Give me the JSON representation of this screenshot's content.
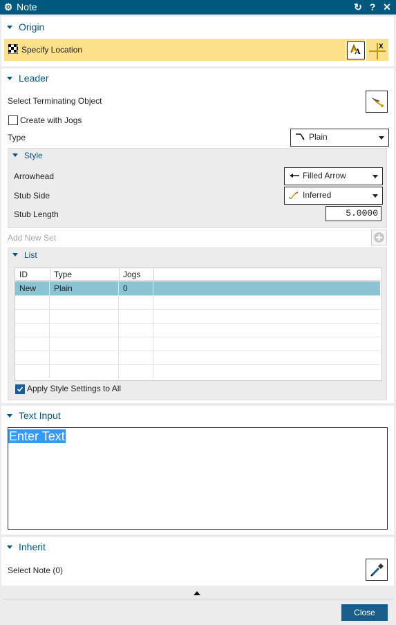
{
  "window": {
    "title": "Note"
  },
  "origin": {
    "header": "Origin",
    "specify_location": "Specify Location"
  },
  "leader": {
    "header": "Leader",
    "select_terminating": "Select Terminating Object",
    "create_with_jogs": "Create with Jogs",
    "create_with_jogs_checked": false,
    "type_label": "Type",
    "type_value": "Plain",
    "style": {
      "header": "Style",
      "arrowhead_label": "Arrowhead",
      "arrowhead_value": "Filled Arrow",
      "stub_side_label": "Stub Side",
      "stub_side_value": "Inferred",
      "stub_length_label": "Stub Length",
      "stub_length_value": "5.0000"
    },
    "add_new_set": "Add New Set",
    "list": {
      "header": "List",
      "columns": [
        "ID",
        "Type",
        "Jogs"
      ],
      "rows": [
        {
          "id": "New",
          "type": "Plain",
          "jogs": "0"
        }
      ],
      "apply_style": "Apply Style Settings to All",
      "apply_style_checked": true
    }
  },
  "text_input": {
    "header": "Text Input",
    "value": "Enter Text"
  },
  "inherit": {
    "header": "Inherit",
    "select_note": "Select Note (0)"
  },
  "footer": {
    "close": "Close"
  },
  "colors": {
    "title_bar": "#00587e",
    "highlight": "#fce08a",
    "row_selected": "#8cc3d3",
    "text_selection": "#3399ff"
  }
}
